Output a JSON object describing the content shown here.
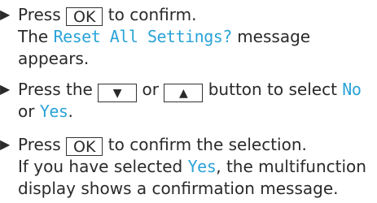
{
  "steps": [
    {
      "bullet": "▶",
      "lines": {
        "l1_a": "Press",
        "l1_key": "OK",
        "l1_b": "to confirm.",
        "l2_a": "The",
        "l2_disp": "Reset All Settings?",
        "l2_b": "message",
        "l3": "appears."
      }
    },
    {
      "bullet": "▶",
      "lines": {
        "l1_a": "Press the",
        "l1_key1": "▼",
        "l1_or": "or",
        "l1_key2": "▲",
        "l1_b": "button to select",
        "l1_no": "No",
        "l2_a": "or",
        "l2_yes": "Yes",
        "l2_b": "."
      }
    },
    {
      "bullet": "▶",
      "lines": {
        "l1_a": "Press",
        "l1_key": "OK",
        "l1_b": "to confirm the selection.",
        "l2_a": "If you have selected",
        "l2_yes": "Yes",
        "l2_b": ", the multifunction",
        "l3": "display shows a confirmation message."
      }
    }
  ],
  "colors": {
    "display_text": "#2aa3d8",
    "body_text": "#2a2a2a"
  }
}
